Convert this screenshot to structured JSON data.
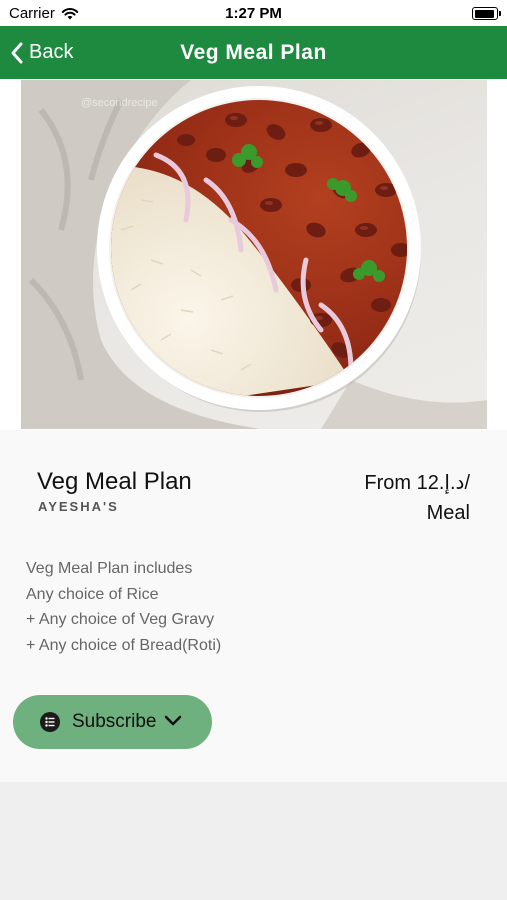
{
  "status_bar": {
    "carrier": "Carrier",
    "time": "1:27 PM"
  },
  "nav": {
    "back_label": "Back",
    "title": "Veg Meal Plan",
    "color": "#1e8a3f"
  },
  "hero_image": {
    "description_icon": "rajma-rice-bowl-image",
    "watermark": "@secondrecipe"
  },
  "plan": {
    "title": "Veg Meal Plan",
    "vendor": "AYESHA'S",
    "price_line1": "From 12.د.إ/",
    "price_line2": "Meal"
  },
  "description": {
    "lines": [
      "Veg Meal Plan includes",
      "Any choice of Rice",
      "+ Any choice of Veg Gravy",
      "+ Any choice of Bread(Roti)"
    ]
  },
  "subscribe": {
    "label": "Subscribe",
    "icon": "list-icon",
    "color": "#6fb07f"
  }
}
